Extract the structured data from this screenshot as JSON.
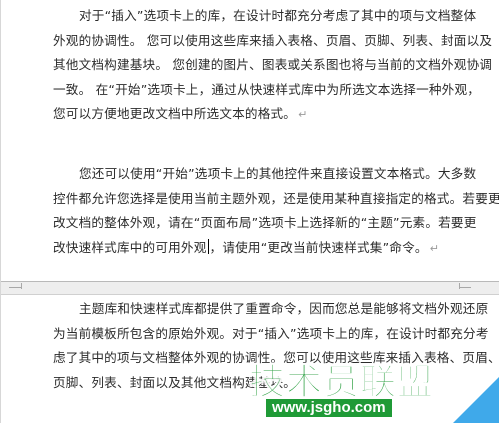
{
  "document": {
    "paragraph1": {
      "lines": [
        "对于“插入”选项卡上的库，在设计时都充分考虑了其中的项与文档整体",
        "外观的协调性。 您可以使用这些库来插入表格、页眉、页脚、列表、封面以及",
        "其他文档构建基块。 您创建的图片、图表或关系图也将与当前的文档外观协调",
        "一致。 在“开始”选项卡上，通过从快速样式库中为所选文本选择一种外观，",
        "您可以方便地更改文档中所选文本的格式。"
      ]
    },
    "paragraph2": {
      "lines": [
        "您还可以使用“开始”选项卡上的其他控件来直接设置文本格式。大多数",
        "控件都允许您选择是使用当前主题外观，还是使用某种直接指定的格式。若要更",
        "改文档的整体外观，请在“页面布局”选项卡上选择新的“主题”元素。若要更",
        "改快速样式库中的可用外观",
        "，请使用“更改当前快速样式集”命令。"
      ]
    },
    "paragraph3": {
      "lines": [
        "主题库和快速样式库都提供了重置命令，因而您总是能够将文档外观还原",
        "为当前模板所包含的原始外观。对于“插入”选项卡上的库，在设计时都充分考",
        "虑了其中的项与文档整体外观的协调性。您可以使用这些库来插入表格、页眉、",
        "页脚、列表、封面以及其他文档构建基块。"
      ]
    },
    "paragraph_mark": "↵"
  },
  "watermark": {
    "title": "技术员联盟",
    "url": "www.jsgho.com"
  }
}
